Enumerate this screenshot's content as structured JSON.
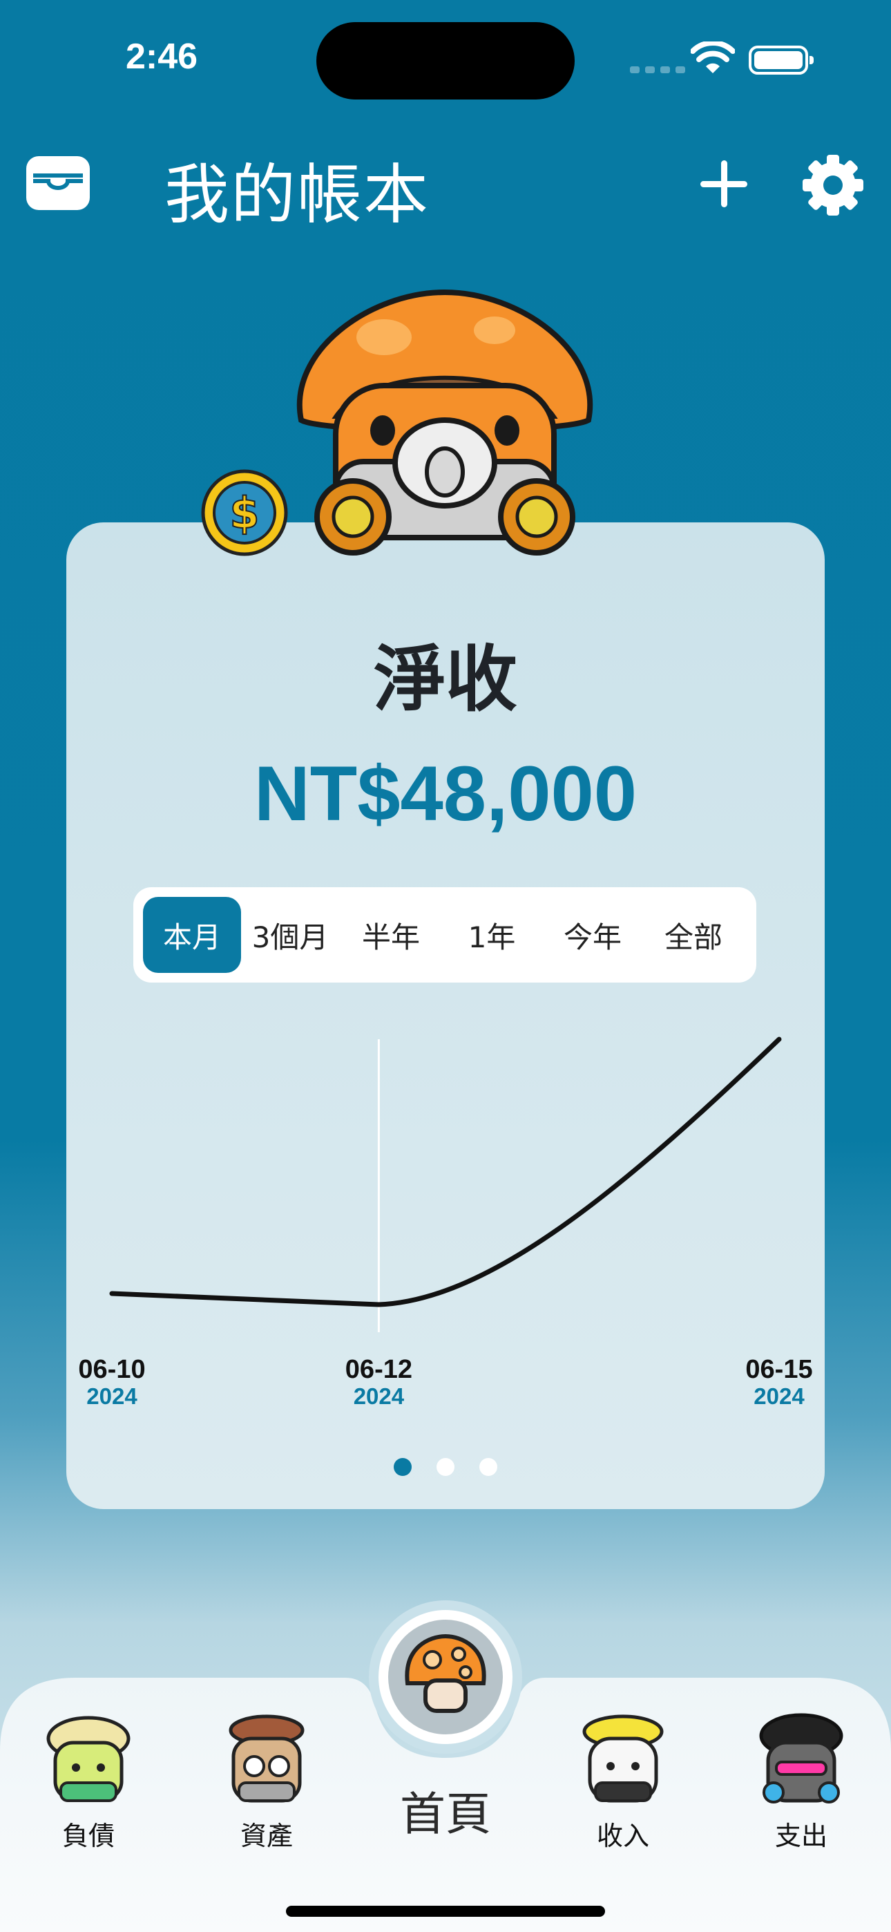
{
  "status_bar": {
    "time": "2:46"
  },
  "header": {
    "title": "我的帳本",
    "wallet_icon": "wallet-icon",
    "add_icon": "plus-icon",
    "settings_icon": "gear-icon"
  },
  "card": {
    "title": "淨收",
    "amount": "NT$48,000",
    "ranges": [
      "本月",
      "3個月",
      "半年",
      "1年",
      "今年",
      "全部"
    ],
    "selected_range": "本月",
    "page_count": 3,
    "current_page": 1
  },
  "chart_data": {
    "type": "line",
    "x": [
      "2024-06-10",
      "2024-06-12",
      "2024-06-15"
    ],
    "tick_labels": [
      {
        "date": "06-10",
        "year": "2024"
      },
      {
        "date": "06-12",
        "year": "2024"
      },
      {
        "date": "06-15",
        "year": "2024"
      }
    ],
    "values": [
      2000,
      0,
      48000
    ],
    "highlight_x": "2024-06-12",
    "grid": false,
    "colors": {
      "line": "#111111",
      "year": "#0a7aa3"
    }
  },
  "tabbar": {
    "items": [
      {
        "label": "負債",
        "icon": "mushroom-debt-icon"
      },
      {
        "label": "資產",
        "icon": "mushroom-assets-icon"
      },
      {
        "label": "首頁",
        "icon": "mushroom-home-icon"
      },
      {
        "label": "收入",
        "icon": "mushroom-income-icon"
      },
      {
        "label": "支出",
        "icon": "mushroom-expense-icon"
      }
    ],
    "selected": "首頁"
  },
  "colors": {
    "accent": "#0a7aa3",
    "background_top": "#077aa3",
    "card": "#d3e6ed"
  }
}
